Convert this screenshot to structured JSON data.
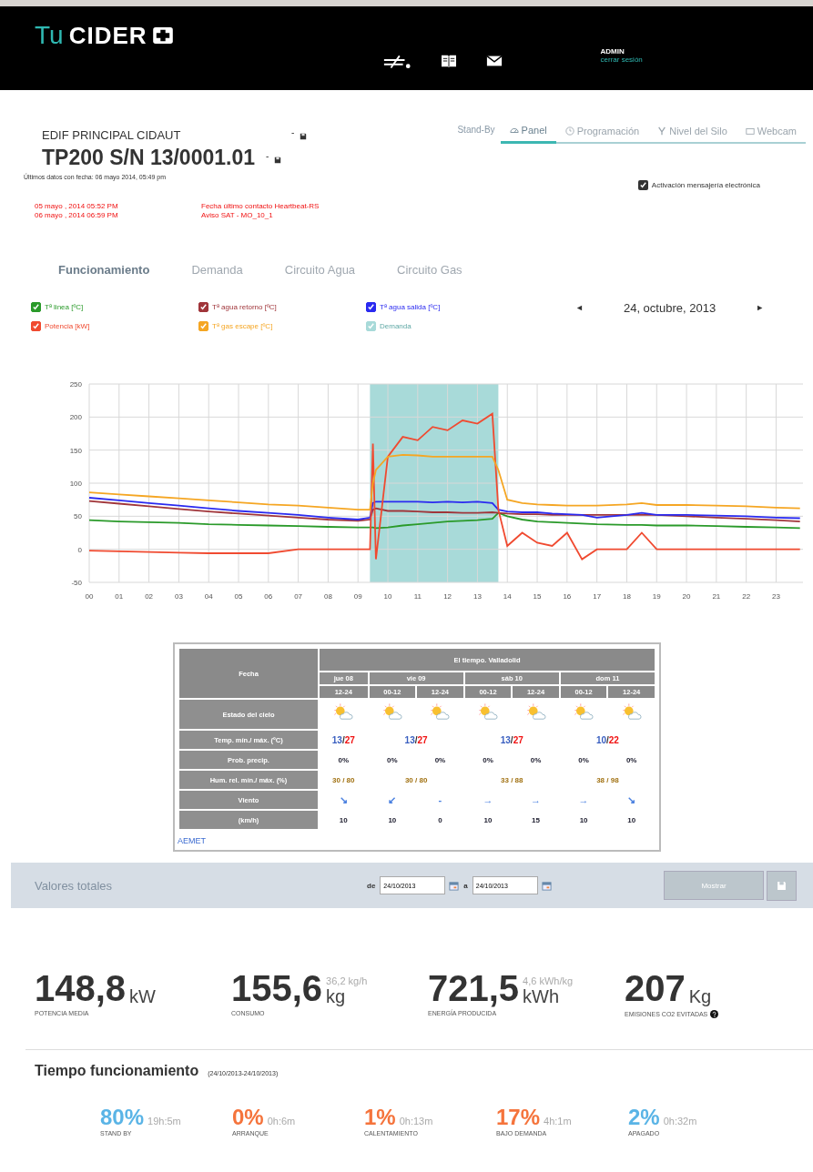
{
  "header": {
    "logo_prefix": "Tu",
    "logo_name": "CIDER",
    "user": "ADMIN",
    "logout": "cerrar sesión"
  },
  "device": {
    "site": "EDIF PRINCIPAL CIDAUT",
    "site_mark": "-",
    "model": "TP200  S/N 13/0001.01",
    "model_mark": "-",
    "last_data": "Últimos datos con fecha: 06 mayo 2014, 05:49 pm",
    "alerts": [
      {
        "date": "05 mayo , 2014 05:52 PM",
        "message": "Fecha último contacto Heartbeat-RS"
      },
      {
        "date": "06 mayo , 2014 06:59 PM",
        "message": "Aviso SAT - MO_10_1"
      }
    ]
  },
  "mode": "Stand-By",
  "view_tabs": [
    {
      "label": "Panel",
      "selected": true
    },
    {
      "label": "Programación",
      "selected": false
    },
    {
      "label": "Nivel del Silo",
      "selected": false
    },
    {
      "label": "Webcam",
      "selected": false
    }
  ],
  "messaging": {
    "label": "Activación mensajería electrónica",
    "checked": true
  },
  "sub_tabs": [
    {
      "label": "Funcionamiento",
      "selected": true
    },
    {
      "label": "Demanda",
      "selected": false
    },
    {
      "label": "Circuito Agua",
      "selected": false
    },
    {
      "label": "Circuito Gas",
      "selected": false
    }
  ],
  "legend": [
    {
      "checked": true
    },
    {
      "checked": true
    },
    {
      "checked": true
    },
    {
      "checked": true
    },
    {
      "checked": true
    },
    {
      "label": "Demanda",
      "color": "#a8dad9",
      "checked": true,
      "disabled": true
    }
  ],
  "date_nav": {
    "prev": "◄",
    "date": "24, octubre, 2013",
    "next": "►"
  },
  "chart_data": {
    "type": "line",
    "grid": true,
    "x": [
      0,
      1,
      2,
      3,
      4,
      5,
      6,
      7,
      8,
      9,
      9.4,
      9.5,
      9.6,
      10,
      10.5,
      11,
      11.5,
      12,
      12.5,
      13,
      13.5,
      13.7,
      14,
      14.5,
      15,
      15.5,
      16,
      16.5,
      17,
      18,
      18.5,
      19,
      20,
      21,
      22,
      23,
      23.8
    ],
    "xlim": [
      0,
      23.9
    ],
    "ylim": [
      -50,
      250
    ],
    "xticks": [
      {
        "value": 0,
        "label": "00"
      },
      {
        "value": 1,
        "label": "01"
      },
      {
        "value": 2,
        "label": "02"
      },
      {
        "value": 3,
        "label": "03"
      },
      {
        "value": 4,
        "label": "04"
      },
      {
        "value": 5,
        "label": "05"
      },
      {
        "value": 6,
        "label": "06"
      },
      {
        "value": 7,
        "label": "07"
      },
      {
        "value": 8,
        "label": "08"
      },
      {
        "value": 9,
        "label": "09"
      },
      {
        "value": 10,
        "label": "10"
      },
      {
        "value": 11,
        "label": "11"
      },
      {
        "value": 12,
        "label": "12"
      },
      {
        "value": 13,
        "label": "13"
      },
      {
        "value": 14,
        "label": "14"
      },
      {
        "value": 15,
        "label": "15"
      },
      {
        "value": 16,
        "label": "16"
      },
      {
        "value": 17,
        "label": "17"
      },
      {
        "value": 18,
        "label": "18"
      },
      {
        "value": 19,
        "label": "19"
      },
      {
        "value": 20,
        "label": "20"
      },
      {
        "value": 21,
        "label": "21"
      },
      {
        "value": 22,
        "label": "22"
      },
      {
        "value": 23,
        "label": "23"
      }
    ],
    "yticks": [
      -50,
      0,
      50,
      100,
      150,
      200,
      250
    ],
    "series": [
      {
        "name": "Tª linea [ºC]",
        "color": "#2a9a2a",
        "values": [
          44,
          42,
          41,
          40,
          38,
          37,
          36,
          35,
          34,
          33,
          33,
          33,
          32,
          33,
          36,
          38,
          40,
          42,
          43,
          44,
          46,
          55,
          50,
          45,
          42,
          41,
          40,
          39,
          38,
          37,
          37,
          36,
          36,
          35,
          34,
          33,
          32
        ]
      },
      {
        "name": "Tª agua retorno [ºC]",
        "color": "#a0353a",
        "values": [
          73,
          69,
          65,
          61,
          57,
          54,
          51,
          48,
          45,
          43,
          45,
          60,
          62,
          58,
          58,
          57,
          56,
          56,
          55,
          55,
          56,
          55,
          54,
          53,
          53,
          52,
          52,
          52,
          52,
          52,
          52,
          52,
          50,
          48,
          46,
          44,
          42
        ]
      },
      {
        "name": "Tª agua salida [ºC]",
        "color": "#2a2af0",
        "values": [
          78,
          74,
          70,
          66,
          62,
          58,
          55,
          52,
          48,
          45,
          48,
          70,
          72,
          72,
          72,
          72,
          71,
          72,
          71,
          72,
          70,
          60,
          57,
          56,
          56,
          54,
          53,
          52,
          48,
          52,
          55,
          52,
          52,
          51,
          50,
          48,
          47
        ]
      },
      {
        "name": "Potencia [kW]",
        "color": "#f04a30",
        "values": [
          -2,
          -3,
          -4,
          -5,
          -6,
          -6,
          -6,
          0,
          0,
          0,
          0,
          160,
          -15,
          140,
          170,
          165,
          185,
          180,
          195,
          190,
          205,
          60,
          5,
          25,
          10,
          5,
          25,
          -15,
          0,
          0,
          25,
          0,
          0,
          0,
          0,
          0,
          0
        ]
      },
      {
        "name": "Tª gas escape [ºC]",
        "color": "#f5a623",
        "values": [
          86,
          83,
          80,
          77,
          74,
          71,
          68,
          66,
          63,
          60,
          60,
          100,
          120,
          140,
          143,
          142,
          140,
          140,
          140,
          140,
          140,
          120,
          75,
          70,
          68,
          67,
          66,
          66,
          66,
          68,
          70,
          67,
          67,
          66,
          65,
          63,
          62
        ]
      }
    ],
    "bands": [
      {
        "axis": "x",
        "from": 9.4,
        "to": 13.7,
        "color": "#a8dad9"
      }
    ]
  },
  "weather": {
    "title": "El tiempo. Valladolid",
    "header_label": "Fecha",
    "days": [
      {
        "label": "jue 08",
        "periods": [
          "12-24"
        ],
        "temp_min": "13",
        "temp_sep": "/",
        "temp_max": "27",
        "humidity": "30 / 80"
      },
      {
        "label": "vie 09",
        "periods": [
          "00-12",
          "12-24"
        ],
        "temp_min": "13",
        "temp_sep": "/",
        "temp_max": "27",
        "humidity": "30 / 80"
      },
      {
        "label": "sáb 10",
        "periods": [
          "00-12",
          "12-24"
        ],
        "temp_min": "13",
        "temp_sep": "/",
        "temp_max": "27",
        "humidity": "33 / 88"
      },
      {
        "label": "dom 11",
        "periods": [
          "00-12",
          "12-24"
        ],
        "temp_min": "10",
        "temp_sep": "/",
        "temp_max": "22",
        "humidity": "38 / 98"
      }
    ],
    "rows": [
      {
        "label": "Estado del cielo",
        "kind": "sky"
      },
      {
        "label": "Temp. mín./ máx. (ºC)",
        "kind": "temp"
      },
      {
        "label": "Prob. precip.",
        "kind": "period",
        "values": [
          "0%",
          "0%",
          "0%",
          "0%",
          "0%",
          "0%",
          "0%"
        ]
      },
      {
        "label": "Hum. rel. mín./ máx. (%)",
        "kind": "humidity"
      },
      {
        "label": "Viento",
        "kind": "wind",
        "values": [
          "↘",
          "↙",
          "-",
          "→",
          "→",
          "→",
          "↘"
        ]
      },
      {
        "label": "(km/h)",
        "kind": "period",
        "values": [
          "10",
          "10",
          "0",
          "10",
          "15",
          "10",
          "10"
        ]
      }
    ],
    "source": "AEMET"
  },
  "totals_bar": {
    "title": "Valores totales",
    "from_label": "de",
    "from": "24/10/2013",
    "to_label": "a",
    "to": "24/10/2013",
    "button": "Mostrar"
  },
  "stats": [
    {
      "value": "148,8",
      "unit": "kW",
      "label": "POTENCIA MEDIA"
    },
    {
      "value": "155,6",
      "unit": "kg",
      "note": "36,2 kg/h",
      "label": "CONSUMO"
    },
    {
      "value": "721,5",
      "unit": "kWh",
      "note": "4,6 kWh/kg",
      "label": "ENERGÍA PRODUCIDA"
    },
    {
      "value": "207",
      "unit": "Kg",
      "label": "EMISIONES CO2 EVITADAS",
      "help": true
    }
  ],
  "runtime": {
    "title": "Tiempo funcionamiento",
    "range": "(24/10/2013-24/10/2013)",
    "states": [
      {
        "percent": "80%",
        "time": "19h:5m",
        "label": "STAND BY",
        "color": "#5ab4e6"
      },
      {
        "percent": "0%",
        "time": "0h:6m",
        "label": "ARRANQUE",
        "color": "#f5743c"
      },
      {
        "percent": "1%",
        "time": "0h:13m",
        "label": "CALENTAMIENTO",
        "color": "#f5743c"
      },
      {
        "percent": "17%",
        "time": "4h:1m",
        "label": "BAJO DEMANDA",
        "color": "#f5743c"
      },
      {
        "percent": "2%",
        "time": "0h:32m",
        "label": "APAGADO",
        "color": "#5ab4e6"
      }
    ]
  }
}
